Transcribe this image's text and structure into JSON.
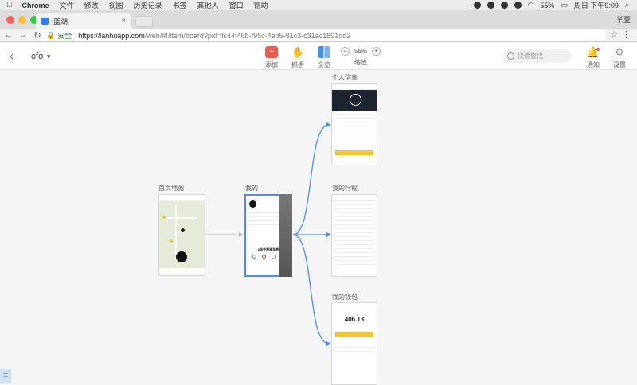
{
  "menubar": {
    "app": "Chrome",
    "items": [
      "文件",
      "修改",
      "视图",
      "历史记录",
      "书签",
      "其他人",
      "窗口",
      "帮助"
    ],
    "battery": "55%",
    "clock": "周日 下午9:09"
  },
  "browser": {
    "tab_title": "蓝湖",
    "profile": "羊夏",
    "secure_label": "安全",
    "url_host": "https://lanhuapp.com",
    "url_path": "/web/#!/item/board?pid=fc44f46b-f95c-4eb5-81c3-c31ac1891dd2"
  },
  "toolbar": {
    "project": "ofo",
    "add_label": "添加",
    "hand_label": "抓手",
    "fit_label": "全览",
    "zoom_value": "55%",
    "zoom_label": "缩放",
    "search_placeholder": "快速查找",
    "notify_label": "通知",
    "settings_label": "设置"
  },
  "boards": {
    "home_map": "首页地图",
    "mine": "我的",
    "personal_info": "个人信息",
    "my_trips": "我的行程",
    "my_wallet": "我的钱包",
    "wallet_balance": "406.13",
    "mine_promo": "5张免费骑车券"
  },
  "colors": {
    "accent": "#4a90e2",
    "add": "#f05a4f",
    "hand": "#f5b700",
    "fit": "#4a90e2",
    "yellow": "#f7c52e"
  },
  "icons": {
    "add": "plus-square-icon",
    "hand": "hand-icon",
    "fit": "grid-icon",
    "search": "search-icon",
    "notify": "bell-icon",
    "settings": "gear-icon"
  }
}
